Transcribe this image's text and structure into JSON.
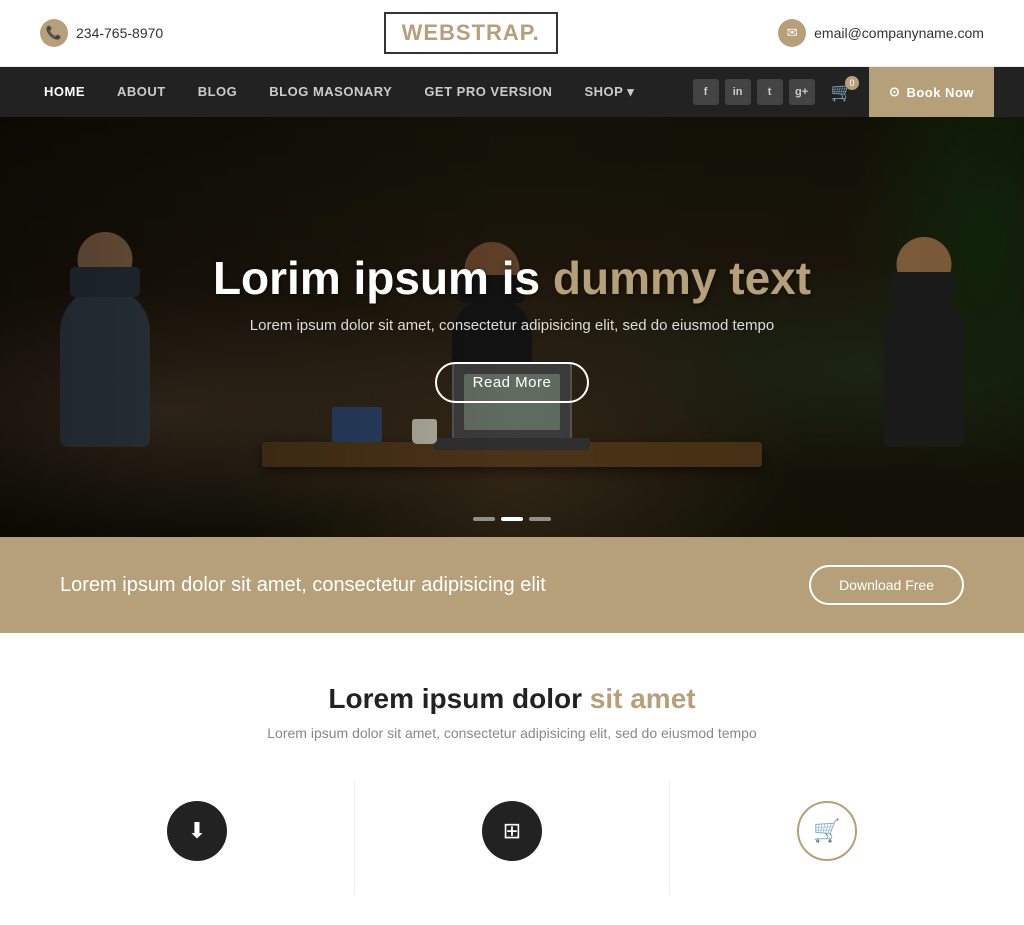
{
  "topbar": {
    "phone": "234-765-8970",
    "email": "email@companyname.com",
    "phone_icon": "📞",
    "email_icon": "✉"
  },
  "logo": {
    "part1": "WEB",
    "part2": "STRAP.",
    "tagline": "."
  },
  "nav": {
    "links": [
      {
        "label": "HOME",
        "active": true
      },
      {
        "label": "ABOUT",
        "active": false
      },
      {
        "label": "BLOG",
        "active": false
      },
      {
        "label": "BLOG MASONARY",
        "active": false
      },
      {
        "label": "GET PRO VERSION",
        "active": false
      },
      {
        "label": "SHOP",
        "active": false,
        "has_dropdown": true
      }
    ],
    "social": [
      {
        "label": "f",
        "name": "facebook"
      },
      {
        "label": "in",
        "name": "linkedin"
      },
      {
        "label": "t",
        "name": "twitter"
      },
      {
        "label": "g+",
        "name": "googleplus"
      }
    ],
    "cart_count": "0",
    "book_now": "Book Now"
  },
  "hero": {
    "title_prefix": "Lorim ipsum is",
    "title_accent": "dummy text",
    "subtitle": "Lorem ipsum dolor sit amet, consectetur adipisicing elit, sed do eiusmod tempo",
    "cta": "Read More",
    "dots": [
      {
        "active": false
      },
      {
        "active": true
      },
      {
        "active": false
      }
    ]
  },
  "promo": {
    "text": "Lorem ipsum dolor sit amet, consectetur adipisicing elit",
    "cta": "Download Free"
  },
  "section": {
    "title_prefix": "Lorem ipsum dolor",
    "title_accent": "sit amet",
    "subtitle": "Lorem ipsum dolor sit amet, consectetur adipisicing elit, sed do eiusmod tempo"
  },
  "icon_cards": [
    {
      "icon": "⬇",
      "type": "dark"
    },
    {
      "icon": "⊞",
      "type": "dark"
    },
    {
      "icon": "🛒",
      "type": "gold"
    }
  ],
  "colors": {
    "accent": "#b5a07a",
    "dark": "#222222",
    "nav_bg": "#222222"
  }
}
